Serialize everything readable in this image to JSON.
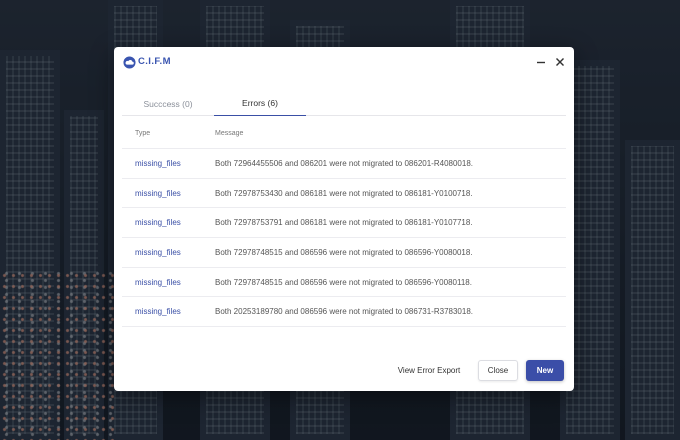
{
  "app": {
    "brand": "C.I.F.M",
    "accent_color": "#3b4ea8",
    "logo_icon": "cloud-icon",
    "minimize_icon": "minimize-icon",
    "close_icon": "close-icon"
  },
  "tabs": [
    {
      "label": "Succcess (0)",
      "active": false
    },
    {
      "label": "Errors (6)",
      "active": true
    }
  ],
  "table": {
    "headers": {
      "type": "Type",
      "message": "Message"
    },
    "rows": [
      {
        "type": "missing_files",
        "message": "Both 72964455506 and 086201 were not migrated to 086201-R4080018."
      },
      {
        "type": "missing_files",
        "message": "Both 72978753430 and 086181 were not migrated to 086181-Y0100718."
      },
      {
        "type": "missing_files",
        "message": "Both 72978753791 and 086181 were not migrated to 086181-Y0107718."
      },
      {
        "type": "missing_files",
        "message": "Both 72978748515 and 086596 were not migrated to 086596-Y0080018."
      },
      {
        "type": "missing_files",
        "message": "Both 72978748515 and 086596 were not migrated to 086596-Y0080118."
      },
      {
        "type": "missing_files",
        "message": "Both 20253189780 and 086596 were not migrated to 086731-R3783018."
      }
    ]
  },
  "footer": {
    "export_label": "View Error Export",
    "close_label": "Close",
    "new_label": "New"
  }
}
